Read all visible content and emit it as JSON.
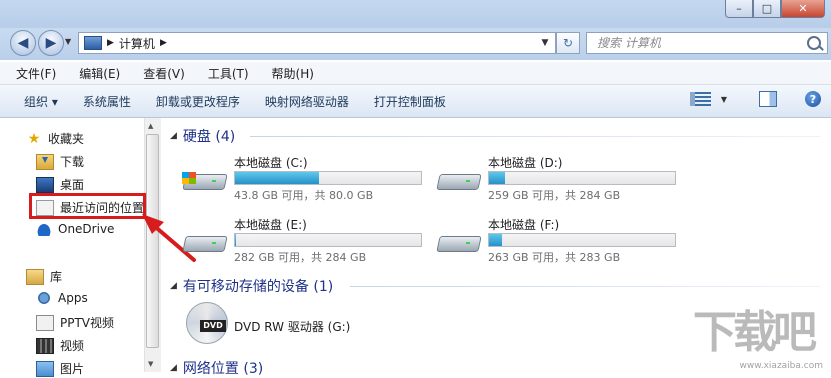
{
  "window": {
    "controls": {
      "minimize": "–",
      "maximize": "□",
      "close": "✕"
    }
  },
  "nav": {
    "back_icon": "back-arrow-icon",
    "forward_icon": "forward-arrow-icon",
    "address": {
      "path": "计算机",
      "icon": "computer-icon"
    },
    "search": {
      "placeholder": "搜索 计算机"
    }
  },
  "menubar": {
    "items": [
      "文件(F)",
      "编辑(E)",
      "查看(V)",
      "工具(T)",
      "帮助(H)"
    ]
  },
  "toolbar": {
    "items": [
      "组织 ▾",
      "系统属性",
      "卸载或更改程序",
      "映射网络驱动器",
      "打开控制面板"
    ]
  },
  "sidebar": {
    "favorites_label": "收藏夹",
    "favorites": [
      "下载",
      "桌面",
      "最近访问的位置",
      "OneDrive"
    ],
    "library_label": "库",
    "library": [
      "Apps",
      "PPTV视频",
      "视频",
      "图片"
    ],
    "highlighted_item": "最近访问的位置"
  },
  "main": {
    "hard_disks": {
      "header": "硬盘 (4)",
      "drives": [
        {
          "name": "本地磁盘 (C:)",
          "info": "43.8 GB 可用，共 80.0 GB",
          "used_fraction": 0.4525
        },
        {
          "name": "本地磁盘 (D:)",
          "info": "259 GB 可用，共 284 GB",
          "used_fraction": 0.088
        },
        {
          "name": "本地磁盘 (E:)",
          "info": "282 GB 可用，共 284 GB",
          "used_fraction": 0.007
        },
        {
          "name": "本地磁盘 (F:)",
          "info": "263 GB 可用，共 283 GB",
          "used_fraction": 0.071
        }
      ]
    },
    "removable": {
      "header": "有可移动存储的设备 (1)",
      "devices": [
        {
          "name": "DVD RW 驱动器 (G:)",
          "badge": "DVD"
        }
      ]
    },
    "network": {
      "header": "网络位置 (3)"
    }
  },
  "watermark": {
    "text": "下载吧",
    "url": "www.xiazaiba.com"
  }
}
